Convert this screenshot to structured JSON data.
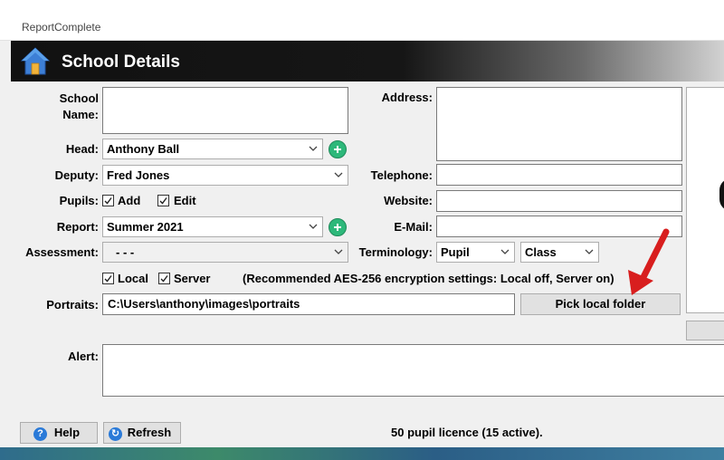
{
  "window": {
    "app_title": "ReportComplete"
  },
  "header": {
    "title": "School Details",
    "icon": "home-icon"
  },
  "form": {
    "school_name": {
      "label": "School\nName:",
      "value": ""
    },
    "head": {
      "label": "Head:",
      "value": "Anthony Ball"
    },
    "deputy": {
      "label": "Deputy:",
      "value": "Fred Jones"
    },
    "pupils": {
      "label": "Pupils:",
      "add": {
        "label": "Add",
        "checked": true
      },
      "edit": {
        "label": "Edit",
        "checked": true
      }
    },
    "report": {
      "label": "Report:",
      "value": "Summer 2021"
    },
    "assessment": {
      "label": "Assessment:",
      "value": "- - -"
    },
    "encryption": {
      "local": {
        "label": "Local",
        "checked": true
      },
      "server": {
        "label": "Server",
        "checked": true
      },
      "note": "(Recommended AES-256 encryption settings: Local off, Server on)"
    },
    "portraits": {
      "label": "Portraits:",
      "value": "C:\\Users\\anthony\\images\\portraits"
    },
    "pick_folder_label": "Pick local folder",
    "address": {
      "label": "Address:",
      "value": ""
    },
    "telephone": {
      "label": "Telephone:",
      "value": ""
    },
    "website": {
      "label": "Website:",
      "value": ""
    },
    "email": {
      "label": "E-Mail:",
      "value": ""
    },
    "terminology": {
      "label": "Terminology:",
      "pupil_value": "Pupil",
      "class_value": "Class"
    },
    "alert": {
      "label": "Alert:",
      "value": ""
    }
  },
  "footer": {
    "help_label": "Help",
    "refresh_label": "Refresh",
    "licence_text": "50 pupil licence (15 active)."
  },
  "colors": {
    "header_dark": "#111111",
    "plus_green": "#2db87a",
    "help_blue": "#2a7ad8",
    "arrow_red": "#d81e1e"
  }
}
